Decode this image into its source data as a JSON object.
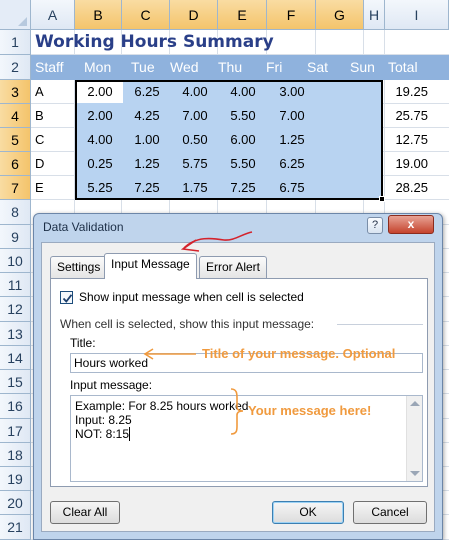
{
  "spreadsheet": {
    "columns": [
      "A",
      "B",
      "C",
      "D",
      "E",
      "F",
      "G",
      "H",
      "I"
    ],
    "rows": [
      "1",
      "2",
      "3",
      "4",
      "5",
      "6",
      "7",
      "8",
      "9",
      "10",
      "11",
      "12",
      "13",
      "14",
      "15",
      "16",
      "17",
      "18",
      "19",
      "20",
      "21"
    ],
    "title": "Working Hours Summary",
    "headers": [
      "Staff",
      "Mon",
      "Tue",
      "Wed",
      "Thu",
      "Fri",
      "Sat",
      "Sun",
      "Total"
    ],
    "data": [
      {
        "staff": "A",
        "hours": [
          "2.00",
          "6.25",
          "4.00",
          "4.00",
          "3.00"
        ],
        "total": "19.25"
      },
      {
        "staff": "B",
        "hours": [
          "2.00",
          "4.25",
          "7.00",
          "5.50",
          "7.00"
        ],
        "total": "25.75"
      },
      {
        "staff": "C",
        "hours": [
          "4.00",
          "1.00",
          "0.50",
          "6.00",
          "1.25"
        ],
        "total": "12.75"
      },
      {
        "staff": "D",
        "hours": [
          "0.25",
          "1.25",
          "5.75",
          "5.50",
          "6.25"
        ],
        "total": "19.00"
      },
      {
        "staff": "E",
        "hours": [
          "5.25",
          "7.25",
          "1.75",
          "7.25",
          "6.75"
        ],
        "total": "28.25"
      }
    ],
    "colors": {
      "title": "#2a3f88",
      "header_band": "#8fb2dd",
      "selection": "#b8d3f1"
    }
  },
  "dialog": {
    "title": "Data Validation",
    "help_label": "?",
    "close_label": "x",
    "tabs": [
      "Settings",
      "Input Message",
      "Error Alert"
    ],
    "active_tab": "Input Message",
    "show_message_checked": true,
    "show_message_label": "Show input message when cell is selected",
    "group_label": "When cell is selected, show this input message:",
    "title_label": "Title:",
    "title_value": "Hours worked",
    "input_message_label": "Input message:",
    "input_message_lines": [
      "Example: For 8.25 hours worked",
      "Input: 8.25",
      "NOT: 8:15"
    ],
    "buttons": {
      "clear_all": "Clear All",
      "ok": "OK",
      "cancel": "Cancel"
    }
  },
  "annotations": {
    "title_note": "Title of your message. Optional",
    "message_note": "Your message here!",
    "color": "#f09a3e"
  }
}
